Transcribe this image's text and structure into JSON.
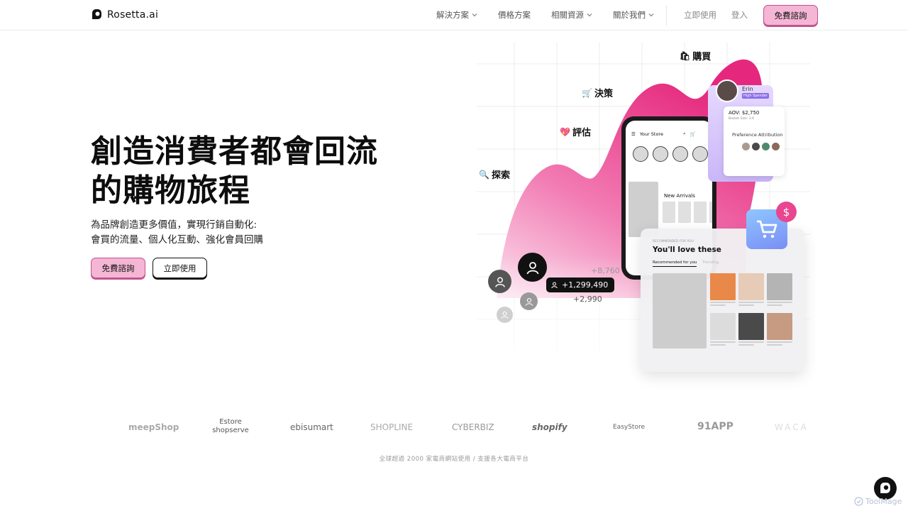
{
  "nav": {
    "brand": "Rosetta.ai",
    "items": [
      {
        "label": "解決方案",
        "dropdown": true
      },
      {
        "label": "價格方案",
        "dropdown": false
      },
      {
        "label": "相關資源",
        "dropdown": true
      },
      {
        "label": "關於我們",
        "dropdown": true
      }
    ],
    "try_label": "立即使用",
    "login_label": "登入",
    "cta_label": "免費諮詢"
  },
  "hero": {
    "title_line1": "創造消費者都會回流",
    "title_line2": "的購物旅程",
    "subtitle_line1": "為品牌創造更多價值，實現行銷自動化:",
    "subtitle_line2": "會買的流量、個人化互動、強化會員回購",
    "primary_button": "免費諮詢",
    "secondary_button": "立即使用"
  },
  "illustration": {
    "steps": {
      "explore": "探索",
      "evaluate": "評估",
      "decide": "決策",
      "buy": "購買"
    },
    "phone": {
      "store_title": "Your Store",
      "section_title": "New Arrivals"
    },
    "profile": {
      "name": "Erin",
      "tag": "High Spender",
      "aov": "AOV: $2,750",
      "basket": "Basket Size: 3.6",
      "preference_title": "Preference Attribution",
      "preference_colors": [
        "#a89c8c",
        "#4a4a4a",
        "#4f8a6e",
        "#8a6a58"
      ]
    },
    "counts": {
      "main": "+1,299,490",
      "upper": "+8,760",
      "lower": "+2,990"
    },
    "recommend": {
      "pretitle": "RECOMMENDED FOR YOU",
      "title": "You'll love these",
      "tab_active": "Recommended for you",
      "tab_inactive": "Trending"
    },
    "dollar_symbol": "$",
    "accent_color": "#e9468f"
  },
  "partners": {
    "logos": [
      "meepShop",
      "Estore shopserve",
      "ebisumart",
      "SHOPLINE",
      "CYBERBIZ",
      "shopify",
      "EasyStore",
      "91APP",
      "WACA"
    ],
    "footnote": "全球超過 2000 家電商網站使用 / 支援各大電商平台"
  },
  "watermark": "ToolMage",
  "colors": {
    "cta_fill": "#f4b6d4",
    "cta_border": "#c2538f",
    "text_dark": "#0d0d0d"
  }
}
